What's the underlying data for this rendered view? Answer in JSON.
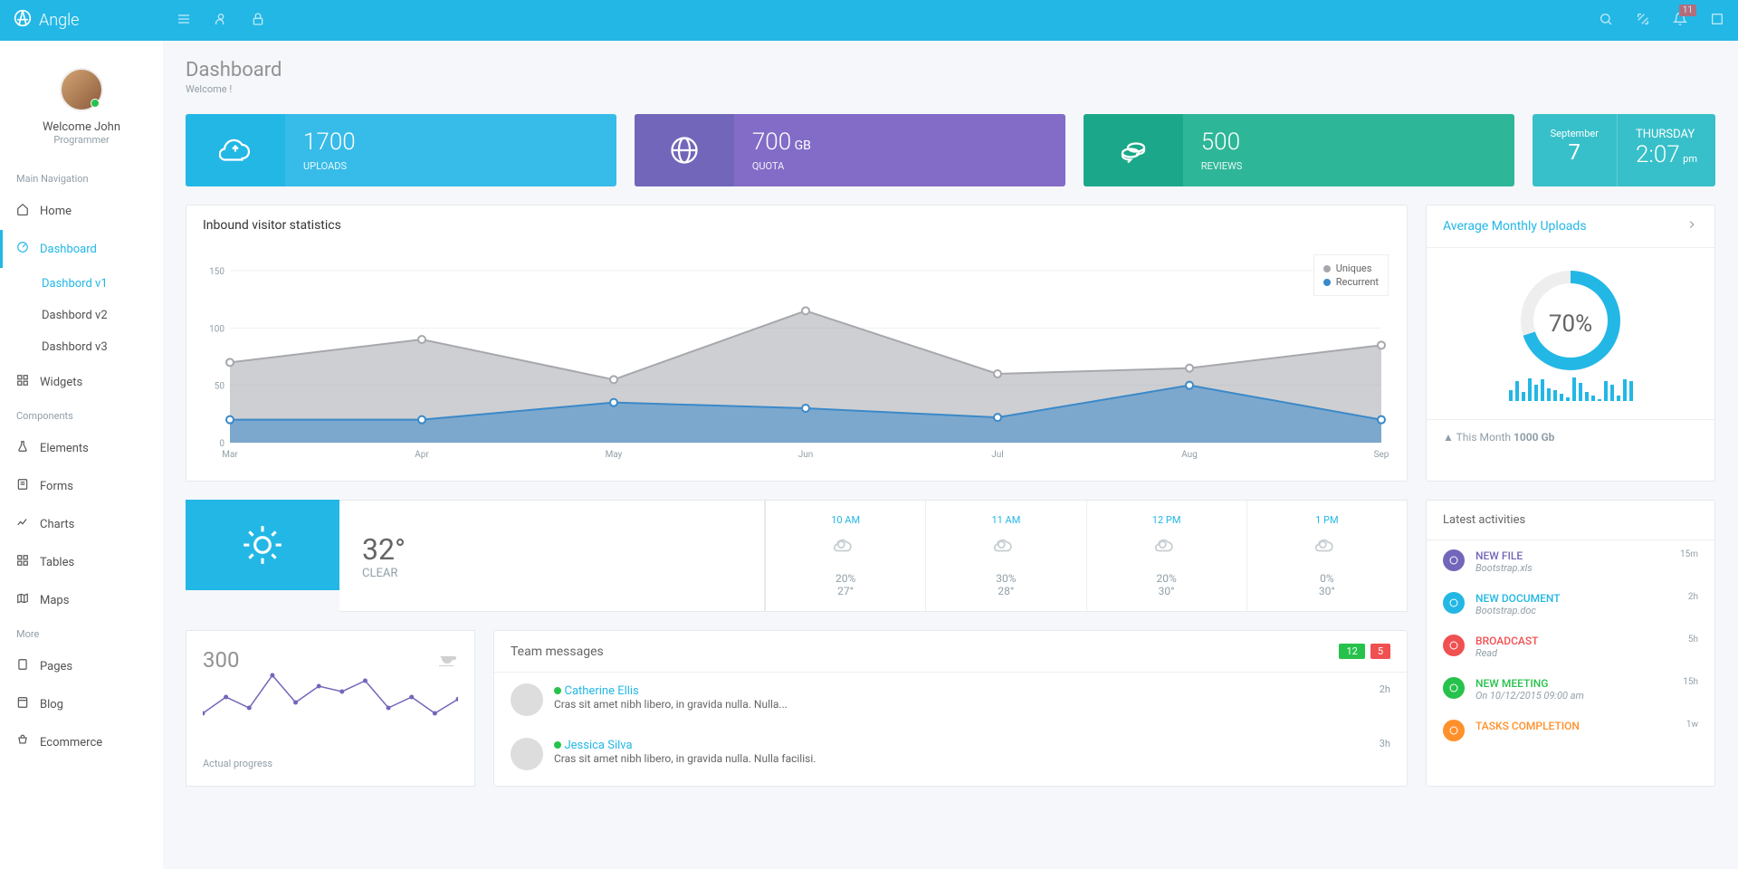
{
  "brand": "Angle",
  "notif_count": "11",
  "profile": {
    "welcome": "Welcome John",
    "role": "Programmer"
  },
  "nav": {
    "section1": "Main Navigation",
    "home": "Home",
    "dashboard": "Dashboard",
    "dash_v1": "Dashbord v1",
    "dash_v2": "Dashbord v2",
    "dash_v3": "Dashbord v3",
    "widgets": "Widgets",
    "section2": "Components",
    "elements": "Elements",
    "forms": "Forms",
    "charts": "Charts",
    "tables": "Tables",
    "maps": "Maps",
    "section3": "More",
    "pages": "Pages",
    "blog": "Blog",
    "ecommerce": "Ecommerce"
  },
  "page": {
    "title": "Dashboard",
    "subtitle": "Welcome !"
  },
  "stats": {
    "uploads": {
      "value": "1700",
      "label": "UPLOADS"
    },
    "quota": {
      "value": "700",
      "unit": "GB",
      "label": "QUOTA"
    },
    "reviews": {
      "value": "500",
      "label": "REVIEWS"
    }
  },
  "date": {
    "month": "September",
    "day": "7",
    "dow": "THURSDAY",
    "time": "2:07",
    "ampm": "pm"
  },
  "chart_data": {
    "type": "area",
    "title": "Inbound visitor statistics",
    "categories": [
      "Mar",
      "Apr",
      "May",
      "Jun",
      "Jul",
      "Aug",
      "Sep"
    ],
    "series": [
      {
        "name": "Uniques",
        "color": "#a6a8ad",
        "values": [
          70,
          90,
          55,
          115,
          60,
          65,
          85
        ]
      },
      {
        "name": "Recurrent",
        "color": "#3a89c9",
        "values": [
          20,
          20,
          35,
          30,
          22,
          50,
          20
        ]
      }
    ],
    "ylim": [
      0,
      150
    ],
    "yticks": [
      0,
      50,
      100,
      150
    ]
  },
  "monthly": {
    "title": "Average Monthly Uploads",
    "percent": "70%",
    "foot_label": "This Month",
    "foot_value": "1000 Gb",
    "bars": [
      12,
      22,
      10,
      25,
      18,
      24,
      14,
      12,
      8,
      4,
      26,
      20,
      10,
      6,
      2,
      22,
      18,
      6,
      24,
      22
    ]
  },
  "weather": {
    "temp": "32°",
    "cond": "CLEAR",
    "forecast": [
      {
        "time": "10 AM",
        "pct": "20%",
        "deg": "27°"
      },
      {
        "time": "11 AM",
        "pct": "30%",
        "deg": "28°"
      },
      {
        "time": "12 PM",
        "pct": "20%",
        "deg": "30°"
      },
      {
        "time": "1 PM",
        "pct": "0%",
        "deg": "30°"
      }
    ]
  },
  "progress": {
    "value": "300",
    "label": "Actual progress",
    "sparkline": [
      25,
      40,
      30,
      60,
      35,
      50,
      45,
      55,
      30,
      40,
      25,
      38
    ]
  },
  "messages": {
    "title": "Team messages",
    "badge1": "12",
    "badge2": "5",
    "items": [
      {
        "name": "Catherine Ellis",
        "text": "Cras sit amet nibh libero, in gravida nulla. Nulla...",
        "time": "2h"
      },
      {
        "name": "Jessica Silva",
        "text": "Cras sit amet nibh libero, in gravida nulla. Nulla facilisi.",
        "time": "3h"
      }
    ]
  },
  "activities": {
    "title": "Latest activities",
    "items": [
      {
        "title": "NEW FILE",
        "sub": "Bootstrap.xls",
        "time": "15m",
        "color": "#7266ba"
      },
      {
        "title": "NEW DOCUMENT",
        "sub": "Bootstrap.doc",
        "time": "2h",
        "color": "#23b7e5"
      },
      {
        "title": "BROADCAST",
        "sub": "Read",
        "time": "5h",
        "color": "#f05050"
      },
      {
        "title": "NEW MEETING",
        "sub": "On 10/12/2015 09:00 am",
        "time": "15h",
        "color": "#27c24c"
      },
      {
        "title": "TASKS COMPLETION",
        "sub": "",
        "time": "1w",
        "color": "#ff902b"
      }
    ]
  }
}
